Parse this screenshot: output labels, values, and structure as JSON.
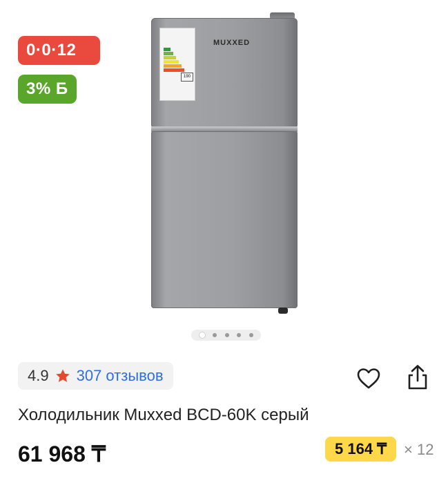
{
  "badges": {
    "installment": "0·0·12",
    "bonus": "3% Б"
  },
  "product_image": {
    "brand": "MUXXED",
    "energy_value": "190",
    "alt": "Холодильник Muxxed BCD-60K серый"
  },
  "carousel": {
    "total": 5,
    "active": 1
  },
  "rating": {
    "score": "4.9",
    "reviews": "307 отзывов"
  },
  "title": "Холодильник Muxxed BCD-60K серый",
  "price": "61 968 ₸",
  "installment": {
    "monthly": "5 164 ₸",
    "months": "× 12"
  },
  "colors": {
    "installment_badge": "#ea4a3e",
    "bonus_badge": "#5aa62a",
    "monthly_badge": "#ffd84a",
    "link": "#2f6fdb",
    "star": "#e5472f"
  },
  "icons": {
    "favorite": "heart-icon",
    "share": "share-icon",
    "rating": "star-icon"
  }
}
